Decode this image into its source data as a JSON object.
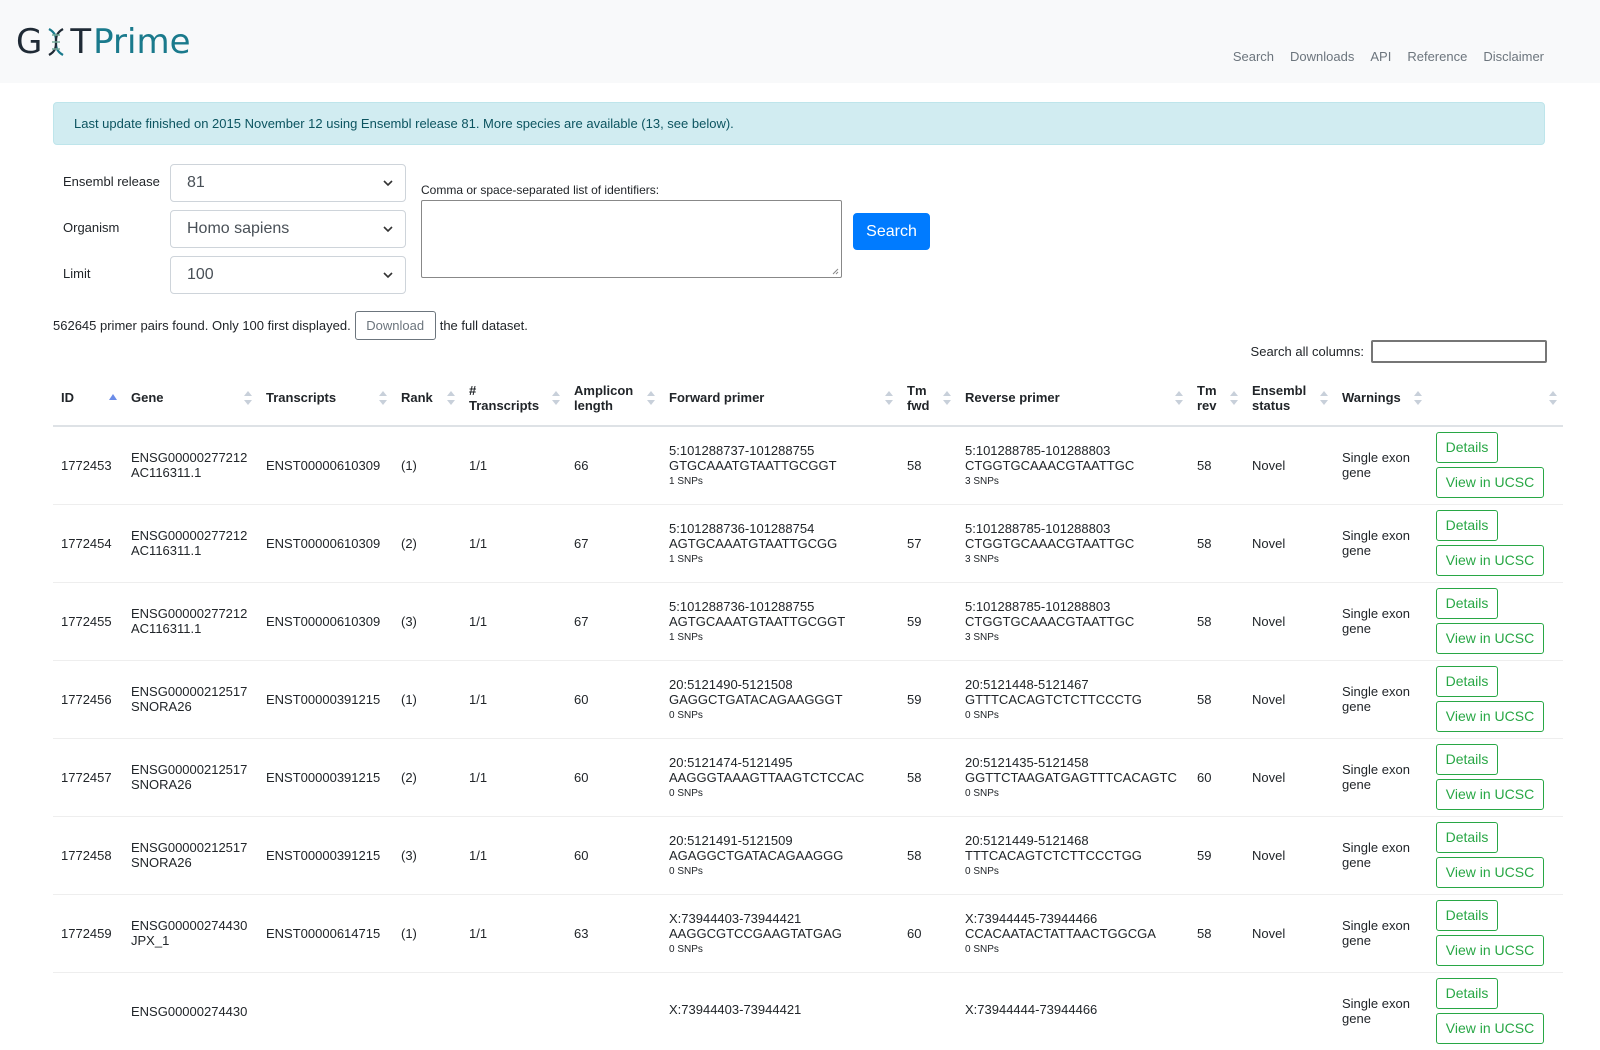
{
  "brand": {
    "left": "G",
    "mid": "T",
    "right": "Prime"
  },
  "nav": [
    "Search",
    "Downloads",
    "API",
    "Reference",
    "Disclaimer"
  ],
  "alert": "Last update finished on 2015 November 12 using Ensembl release 81. More species are available (13, see below).",
  "form": {
    "release_label": "Ensembl release",
    "release_value": "81",
    "organism_label": "Organism",
    "organism_value": "Homo sapiens",
    "limit_label": "Limit",
    "limit_value": "100",
    "ids_label": "Comma or space-separated list of identifiers:",
    "search_button": "Search"
  },
  "results": {
    "found_text": "562645 primer pairs found. Only 100 first displayed.",
    "download_button": "Download",
    "suffix_text": "the full dataset.",
    "search_all_label": "Search all columns:"
  },
  "table": {
    "headers": [
      "ID",
      "Gene",
      "Transcripts",
      "Rank",
      "# Transcripts",
      "Amplicon length",
      "Forward primer",
      "Tm fwd",
      "Reverse primer",
      "Tm rev",
      "Ensembl status",
      "Warnings",
      ""
    ],
    "details_label": "Details",
    "ucsc_label": "View in UCSC",
    "rows": [
      {
        "id": "1772453",
        "gene": "ENSG00000277212",
        "gene_name": "AC116311.1",
        "transcript": "ENST00000610309",
        "rank": "(1)",
        "ntx": "1/1",
        "amplicon": "66",
        "fwd_loc": "5:101288737-101288755",
        "fwd_seq": "GTGCAAATGTAATTGCGGT",
        "fwd_snps": "1 SNPs",
        "tm_fwd": "58",
        "rev_loc": "5:101288785-101288803",
        "rev_seq": "CTGGTGCAAACGTAATTGC",
        "rev_snps": "3 SNPs",
        "tm_rev": "58",
        "status": "Novel",
        "warning": "Single exon gene"
      },
      {
        "id": "1772454",
        "gene": "ENSG00000277212",
        "gene_name": "AC116311.1",
        "transcript": "ENST00000610309",
        "rank": "(2)",
        "ntx": "1/1",
        "amplicon": "67",
        "fwd_loc": "5:101288736-101288754",
        "fwd_seq": "AGTGCAAATGTAATTGCGG",
        "fwd_snps": "1 SNPs",
        "tm_fwd": "57",
        "rev_loc": "5:101288785-101288803",
        "rev_seq": "CTGGTGCAAACGTAATTGC",
        "rev_snps": "3 SNPs",
        "tm_rev": "58",
        "status": "Novel",
        "warning": "Single exon gene"
      },
      {
        "id": "1772455",
        "gene": "ENSG00000277212",
        "gene_name": "AC116311.1",
        "transcript": "ENST00000610309",
        "rank": "(3)",
        "ntx": "1/1",
        "amplicon": "67",
        "fwd_loc": "5:101288736-101288755",
        "fwd_seq": "AGTGCAAATGTAATTGCGGT",
        "fwd_snps": "1 SNPs",
        "tm_fwd": "59",
        "rev_loc": "5:101288785-101288803",
        "rev_seq": "CTGGTGCAAACGTAATTGC",
        "rev_snps": "3 SNPs",
        "tm_rev": "58",
        "status": "Novel",
        "warning": "Single exon gene"
      },
      {
        "id": "1772456",
        "gene": "ENSG00000212517",
        "gene_name": "SNORA26",
        "transcript": "ENST00000391215",
        "rank": "(1)",
        "ntx": "1/1",
        "amplicon": "60",
        "fwd_loc": "20:5121490-5121508",
        "fwd_seq": "GAGGCTGATACAGAAGGGT",
        "fwd_snps": "0 SNPs",
        "tm_fwd": "59",
        "rev_loc": "20:5121448-5121467",
        "rev_seq": "GTTTCACAGTCTCTTCCCTG",
        "rev_snps": "0 SNPs",
        "tm_rev": "58",
        "status": "Novel",
        "warning": "Single exon gene"
      },
      {
        "id": "1772457",
        "gene": "ENSG00000212517",
        "gene_name": "SNORA26",
        "transcript": "ENST00000391215",
        "rank": "(2)",
        "ntx": "1/1",
        "amplicon": "60",
        "fwd_loc": "20:5121474-5121495",
        "fwd_seq": "AAGGGTAAAGTTAAGTCTCCAC",
        "fwd_snps": "0 SNPs",
        "tm_fwd": "58",
        "rev_loc": "20:5121435-5121458",
        "rev_seq": "GGTTCTAAGATGAGTTTCACAGTC",
        "rev_snps": "0 SNPs",
        "tm_rev": "60",
        "status": "Novel",
        "warning": "Single exon gene"
      },
      {
        "id": "1772458",
        "gene": "ENSG00000212517",
        "gene_name": "SNORA26",
        "transcript": "ENST00000391215",
        "rank": "(3)",
        "ntx": "1/1",
        "amplicon": "60",
        "fwd_loc": "20:5121491-5121509",
        "fwd_seq": "AGAGGCTGATACAGAAGGG",
        "fwd_snps": "0 SNPs",
        "tm_fwd": "58",
        "rev_loc": "20:5121449-5121468",
        "rev_seq": "TTTCACAGTCTCTTCCCTGG",
        "rev_snps": "0 SNPs",
        "tm_rev": "59",
        "status": "Novel",
        "warning": "Single exon gene"
      },
      {
        "id": "1772459",
        "gene": "ENSG00000274430",
        "gene_name": "JPX_1",
        "transcript": "ENST00000614715",
        "rank": "(1)",
        "ntx": "1/1",
        "amplicon": "63",
        "fwd_loc": "X:73944403-73944421",
        "fwd_seq": "AAGGCGTCCGAAGTATGAG",
        "fwd_snps": "0 SNPs",
        "tm_fwd": "60",
        "rev_loc": "X:73944445-73944466",
        "rev_seq": "CCACAATACTATTAACTGGCGA",
        "rev_snps": "0 SNPs",
        "tm_rev": "58",
        "status": "Novel",
        "warning": "Single exon gene"
      },
      {
        "id": "",
        "gene": "ENSG00000274430",
        "gene_name": "",
        "transcript": "",
        "rank": "",
        "ntx": "",
        "amplicon": "",
        "fwd_loc": "X:73944403-73944421",
        "fwd_seq": "",
        "fwd_snps": "",
        "tm_fwd": "",
        "rev_loc": "X:73944444-73944466",
        "rev_seq": "",
        "rev_snps": "",
        "tm_rev": "",
        "status": "",
        "warning": "Single exon gene"
      }
    ]
  }
}
